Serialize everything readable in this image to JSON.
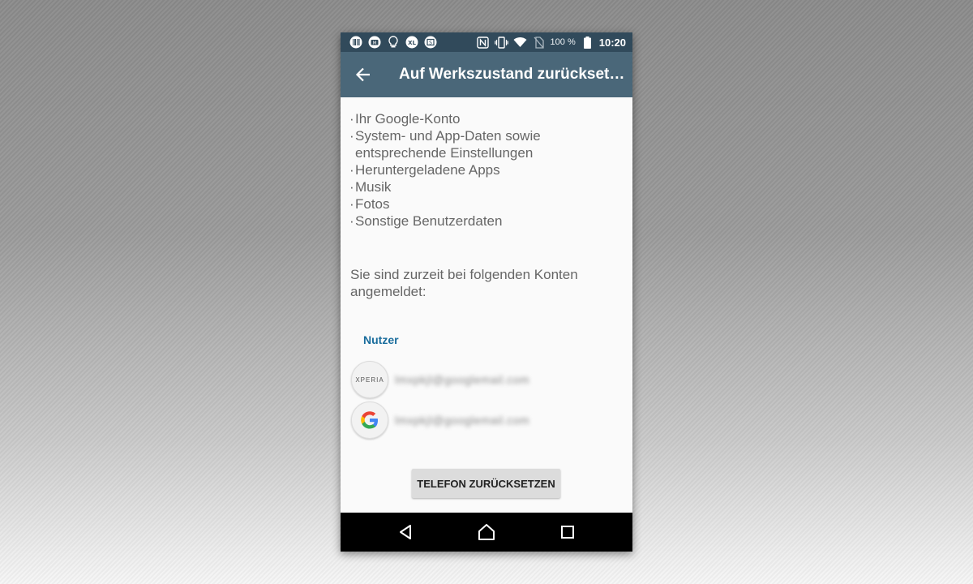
{
  "status_bar": {
    "left_icons": [
      "barcode-app-icon",
      "m-app-icon",
      "lightbulb-icon",
      "xl-app-icon",
      "s-app-icon"
    ],
    "right_icons": [
      "nfc-icon",
      "vibrate-icon",
      "wifi-icon",
      "no-sim-icon"
    ],
    "battery": "100 %",
    "time": "10:20"
  },
  "app_bar": {
    "title": "Auf Werkszustand zurücksetz..."
  },
  "erase_items": [
    "Ihr Google-Konto",
    "System- und App-Daten sowie entsprechende Einstellungen",
    "Heruntergeladene Apps",
    "Musik",
    "Fotos",
    "Sonstige Benutzerdaten"
  ],
  "accounts_intro": "Sie sind zurzeit bei folgenden Konten angemeldet:",
  "accounts_section": "Nutzer",
  "accounts": [
    {
      "type": "xperia",
      "avatar_label": "XPERIA",
      "email": "lmxpkjl@googlemail.com"
    },
    {
      "type": "google",
      "avatar_label": "G",
      "email": "lmxpkjl@googlemail.com"
    }
  ],
  "reset_button": "TELEFON ZURÜCKSETZEN",
  "colors": {
    "status_bar": "#314a5b",
    "app_bar": "#4a6779",
    "accent": "#196c9c",
    "nav_bar": "#000000"
  }
}
